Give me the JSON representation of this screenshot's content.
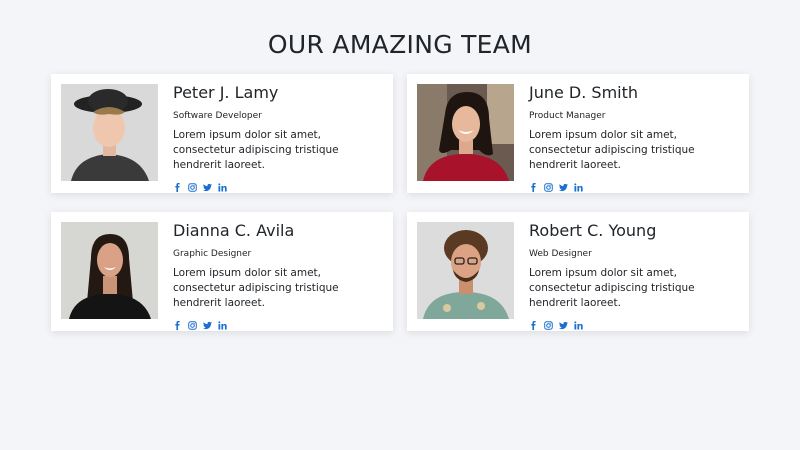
{
  "page": {
    "title": "OUR AMAZING TEAM"
  },
  "colors": {
    "social_icon": "#1a6fd1",
    "background": "#f4f5f8",
    "card": "#ffffff"
  },
  "social_icons": [
    "facebook-icon",
    "instagram-icon",
    "twitter-icon",
    "linkedin-icon"
  ],
  "team": [
    {
      "name": "Peter J. Lamy",
      "role": "Software Developer",
      "description": "Lorem ipsum dolor sit amet, consectetur adipiscing tristique hendrerit laoreet."
    },
    {
      "name": "June D. Smith",
      "role": "Product Manager",
      "description": "Lorem ipsum dolor sit amet, consectetur adipiscing tristique hendrerit laoreet."
    },
    {
      "name": "Dianna C. Avila",
      "role": "Graphic Designer",
      "description": "Lorem ipsum dolor sit amet, consectetur adipiscing tristique hendrerit laoreet."
    },
    {
      "name": "Robert C. Young",
      "role": "Web Designer",
      "description": "Lorem ipsum dolor sit amet, consectetur adipiscing tristique hendrerit laoreet."
    }
  ]
}
